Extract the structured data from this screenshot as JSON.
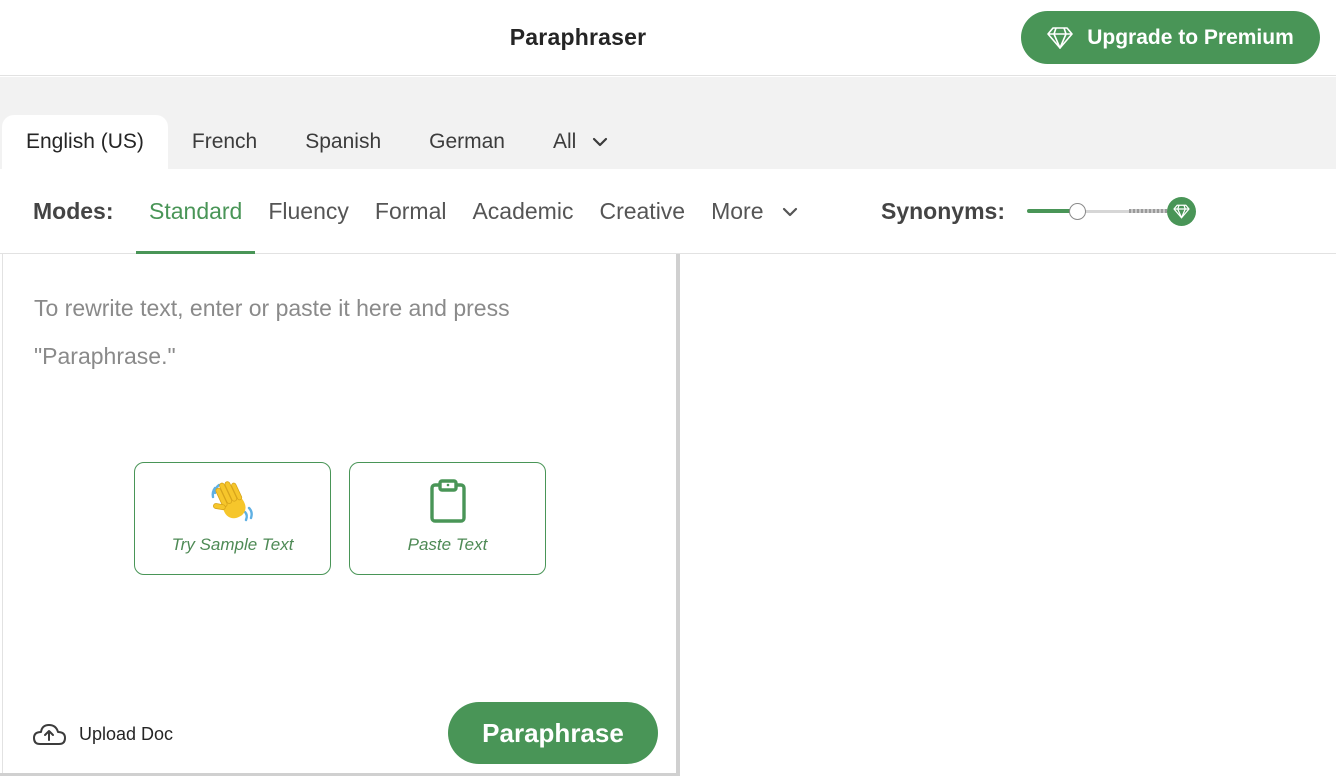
{
  "theme": {
    "accent": "#499557"
  },
  "header": {
    "title": "Paraphraser",
    "premium_button": {
      "label": "Upgrade to Premium",
      "icon": "diamond-icon"
    }
  },
  "languages": {
    "tabs": [
      {
        "label": "English (US)",
        "active": true
      },
      {
        "label": "French",
        "active": false
      },
      {
        "label": "Spanish",
        "active": false
      },
      {
        "label": "German",
        "active": false
      },
      {
        "label": "All",
        "active": false,
        "icon": "chevron-down-icon"
      }
    ]
  },
  "modes": {
    "label": "Modes:",
    "items": [
      {
        "label": "Standard",
        "active": true
      },
      {
        "label": "Fluency",
        "active": false
      },
      {
        "label": "Formal",
        "active": false
      },
      {
        "label": "Academic",
        "active": false
      },
      {
        "label": "Creative",
        "active": false
      },
      {
        "label": "More",
        "active": false,
        "icon": "chevron-down-icon"
      }
    ]
  },
  "synonyms": {
    "label": "Synonyms:",
    "slider_level": 0.3,
    "premium_icon": "diamond-icon"
  },
  "editor": {
    "placeholder": "To rewrite text, enter or paste it here and press \"Paraphrase.\"",
    "actions": [
      {
        "label": "Try Sample Text",
        "icon": "waving-hand-icon"
      },
      {
        "label": "Paste Text",
        "icon": "clipboard-icon"
      }
    ],
    "upload_label": "Upload Doc",
    "upload_icon": "cloud-upload-icon",
    "submit_label": "Paraphrase"
  }
}
